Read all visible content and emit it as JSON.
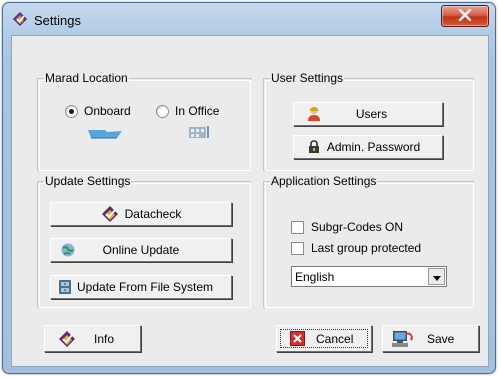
{
  "window": {
    "title": "Settings",
    "icons": {
      "title": "diamond-app-icon",
      "close": "close-x-icon"
    }
  },
  "marad": {
    "label": "Marad Location",
    "options": [
      {
        "label": "Onboard",
        "checked": true,
        "icon": "ship-icon"
      },
      {
        "label": "In Office",
        "checked": false,
        "icon": "office-building-icon"
      }
    ]
  },
  "user_settings": {
    "label": "User Settings",
    "users_button": {
      "label": "Users",
      "icon": "user-icon"
    },
    "admin_button": {
      "label": "Admin. Password",
      "icon": "padlock-icon"
    }
  },
  "update_settings": {
    "label": "Update Settings",
    "datacheck_button": {
      "label": "Datacheck",
      "icon": "diamond-check-icon"
    },
    "online_button": {
      "label": "Online Update",
      "icon": "globe-update-icon"
    },
    "filesystem_button": {
      "label": "Update From File System",
      "icon": "file-cabinet-icon"
    }
  },
  "app_settings": {
    "label": "Application Settings",
    "subgr_codes": {
      "label": "Subgr-Codes ON",
      "checked": false
    },
    "last_group": {
      "label": "Last group protected",
      "checked": false
    },
    "language": {
      "value": "English"
    }
  },
  "footer": {
    "info_button": {
      "label": "Info",
      "icon": "diamond-info-icon"
    },
    "cancel_button": {
      "label": "Cancel",
      "icon": "cancel-x-icon"
    },
    "save_button": {
      "label": "Save",
      "icon": "save-computer-icon"
    }
  },
  "colors": {
    "dialog_bg": "#ebebeb",
    "title_bar": "#b3cce6",
    "close_button": "#c2321b"
  }
}
